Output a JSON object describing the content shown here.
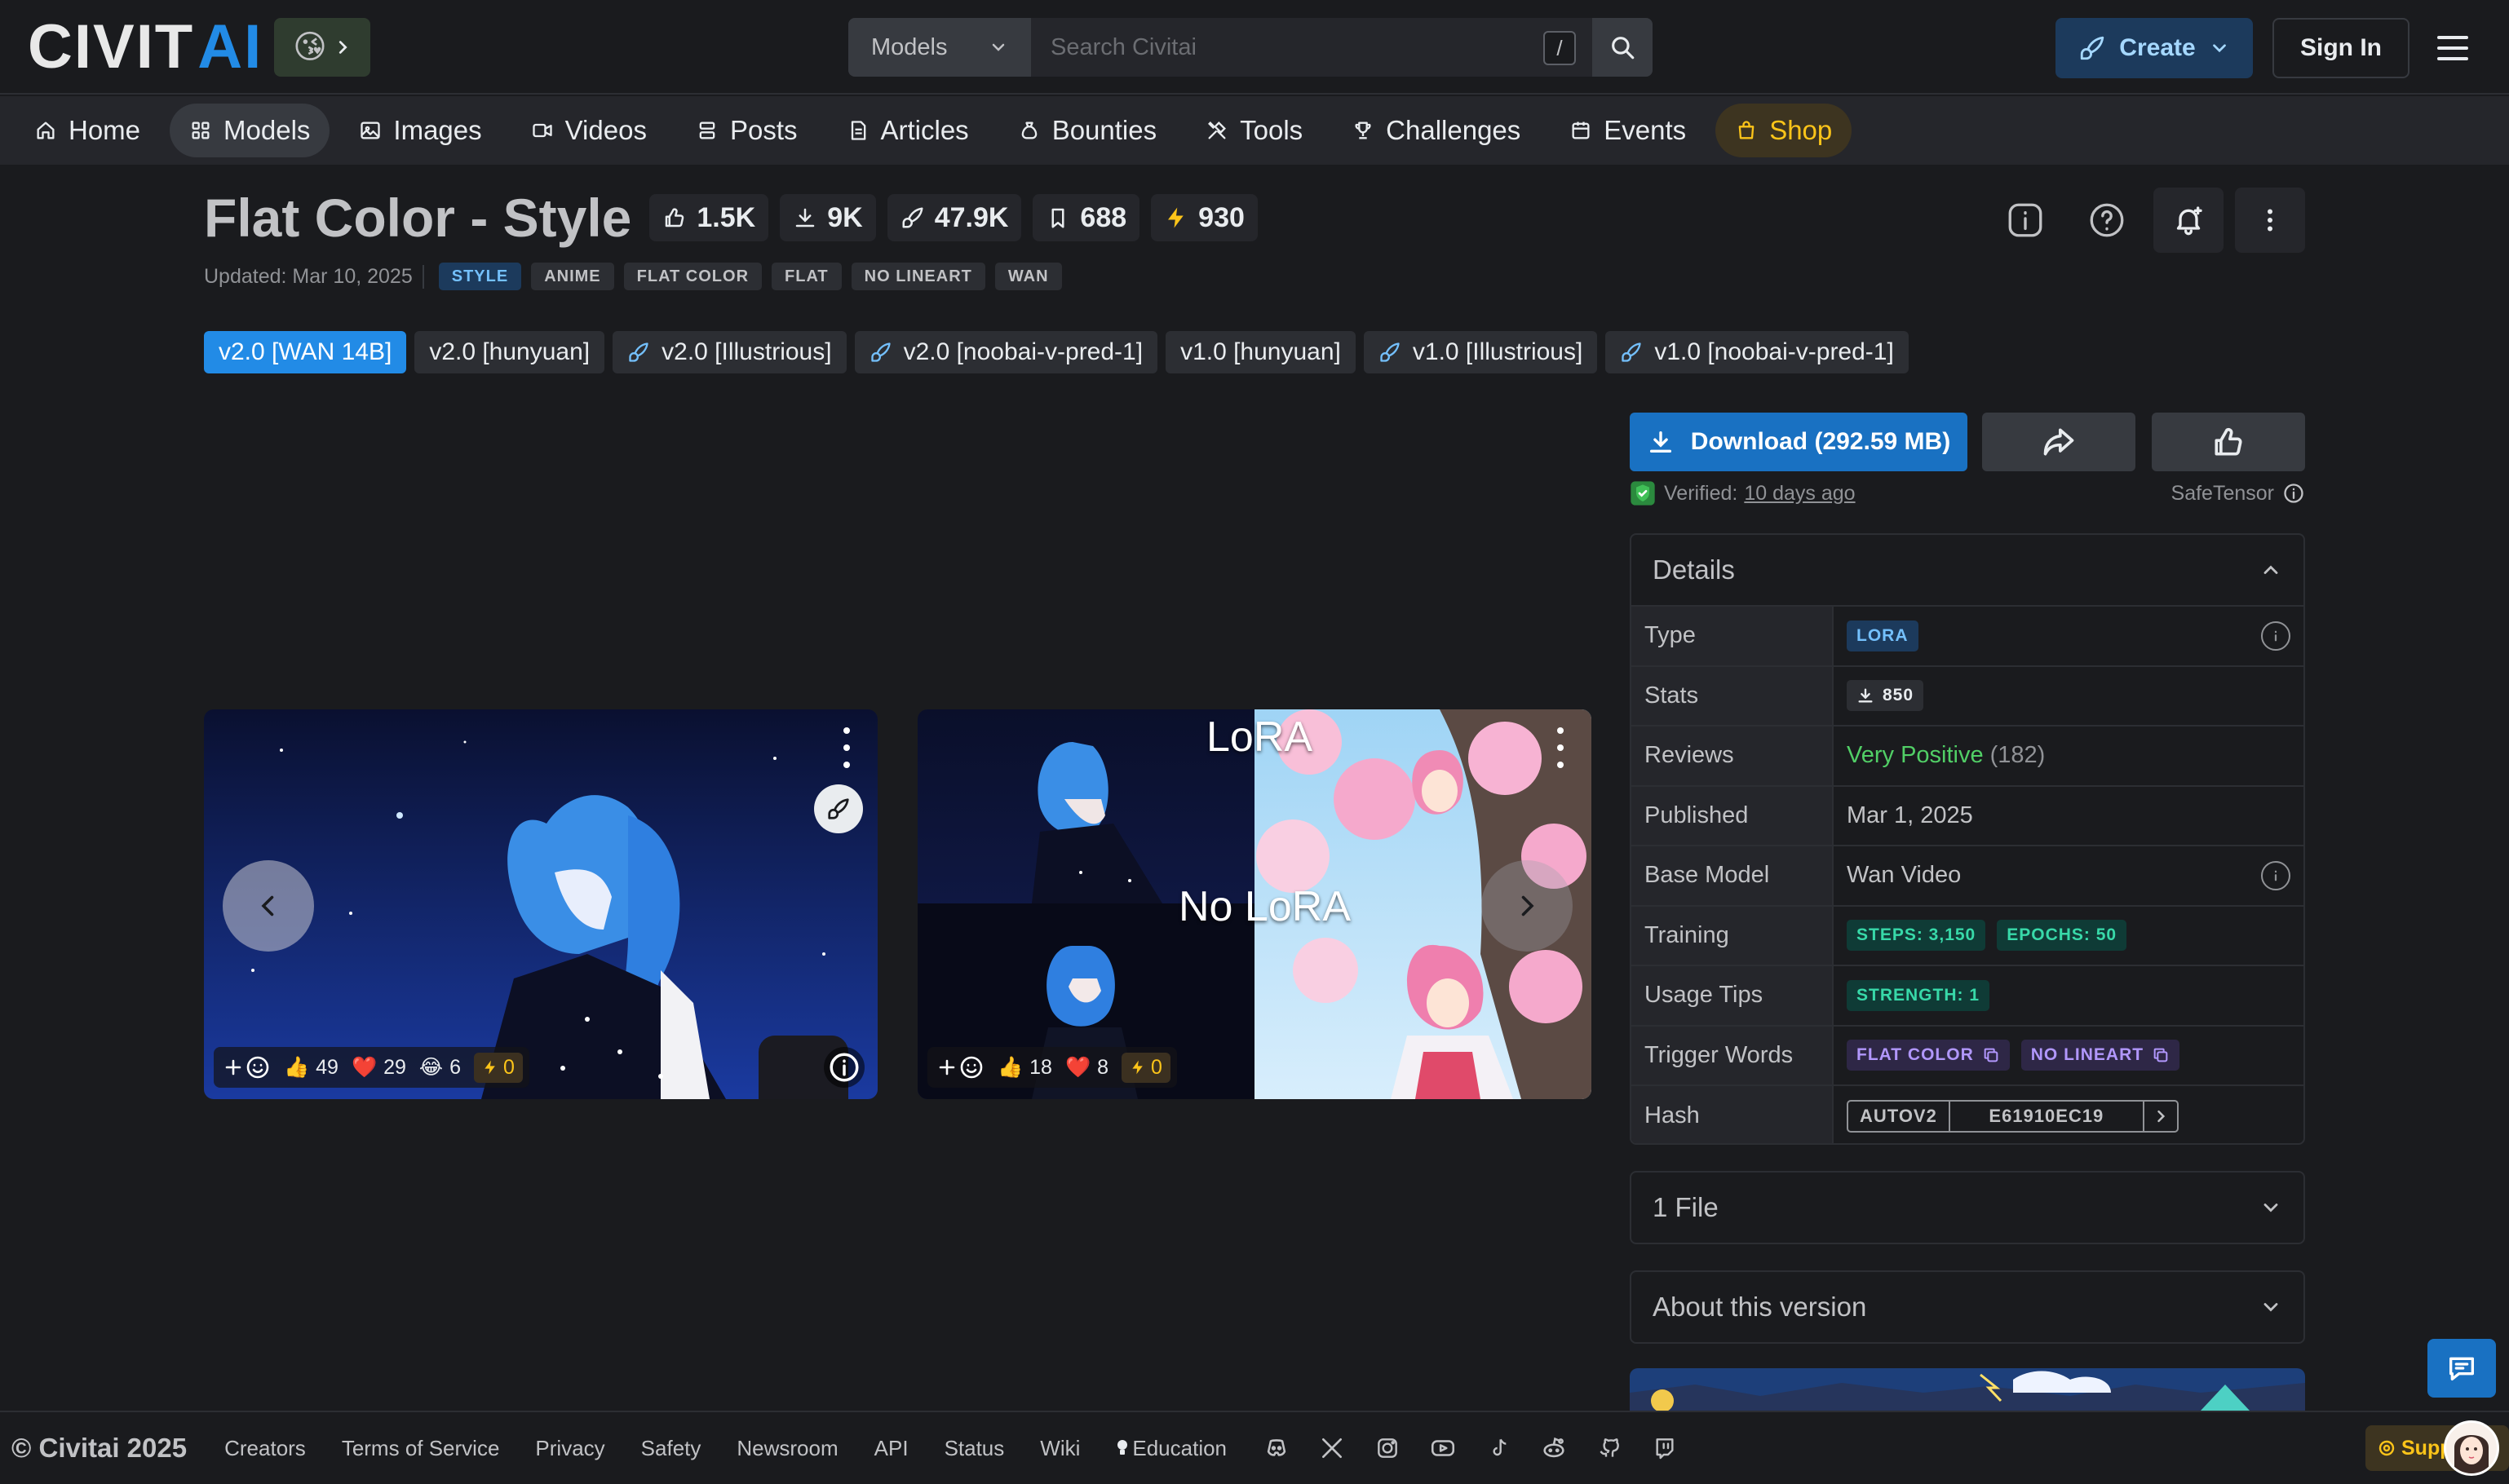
{
  "header": {
    "logo_a": "CIVIT",
    "logo_b": "AI",
    "emoji": "😘",
    "search": {
      "scope": "Models",
      "placeholder": "Search Civitai",
      "shortcut": "/"
    },
    "create_label": "Create",
    "signin_label": "Sign In"
  },
  "nav": {
    "items": [
      {
        "label": "Home",
        "icon": "home-icon"
      },
      {
        "label": "Models",
        "icon": "grid-icon"
      },
      {
        "label": "Images",
        "icon": "photo-icon"
      },
      {
        "label": "Videos",
        "icon": "video-icon"
      },
      {
        "label": "Posts",
        "icon": "stack-icon"
      },
      {
        "label": "Articles",
        "icon": "article-icon"
      },
      {
        "label": "Bounties",
        "icon": "moneybag-icon"
      },
      {
        "label": "Tools",
        "icon": "tools-icon"
      },
      {
        "label": "Challenges",
        "icon": "trophy-icon"
      },
      {
        "label": "Events",
        "icon": "calendar-icon"
      },
      {
        "label": "Shop",
        "icon": "shopping-bag-icon"
      }
    ],
    "active": "Models"
  },
  "model": {
    "title": "Flat Color - Style",
    "stats": {
      "likes": "1.5K",
      "downloads": "9K",
      "generations": "47.9K",
      "bookmarks": "688",
      "buzz": "930"
    },
    "updated": "Updated: Mar 10, 2025",
    "tags": [
      "STYLE",
      "ANIME",
      "FLAT COLOR",
      "FLAT",
      "NO LINEART",
      "WAN"
    ]
  },
  "versions": [
    {
      "label": "v2.0 [WAN 14B]",
      "active": true,
      "linked": false
    },
    {
      "label": "v2.0 [hunyuan]",
      "active": false,
      "linked": false
    },
    {
      "label": "v2.0 [Illustrious]",
      "active": false,
      "linked": true
    },
    {
      "label": "v2.0 [noobai-v-pred-1]",
      "active": false,
      "linked": true
    },
    {
      "label": "v1.0 [hunyuan]",
      "active": false,
      "linked": false
    },
    {
      "label": "v1.0 [Illustrious]",
      "active": false,
      "linked": true
    },
    {
      "label": "v1.0 [noobai-v-pred-1]",
      "active": false,
      "linked": true
    }
  ],
  "gallery": {
    "card1": {
      "reactions": {
        "like": "49",
        "heart": "29",
        "laugh": "6",
        "buzz": "0"
      }
    },
    "card2": {
      "reactions": {
        "like": "18",
        "heart": "8",
        "buzz": "0"
      },
      "overlay_top": "LoRA",
      "overlay_mid": "No LoRA"
    }
  },
  "download": {
    "label": "Download (292.59 MB)",
    "verified_text": "Verified:",
    "verified_time": "10 days ago",
    "format": "SafeTensor"
  },
  "details": {
    "title": "Details",
    "rows": {
      "type_key": "Type",
      "type_val": "LORA",
      "stats_key": "Stats",
      "stats_val": "850",
      "reviews_key": "Reviews",
      "reviews_positive": "Very Positive",
      "reviews_count": "(182)",
      "published_key": "Published",
      "published_val": "Mar 1, 2025",
      "base_key": "Base Model",
      "base_val": "Wan Video",
      "training_key": "Training",
      "steps": "STEPS: 3,150",
      "epochs": "EPOCHS: 50",
      "tips_key": "Usage Tips",
      "strength": "STRENGTH: 1",
      "trigger_key": "Trigger Words",
      "trigger1": "FLAT COLOR",
      "trigger2": "NO LINEART",
      "hash_key": "Hash",
      "hash_type": "AUTOV2",
      "hash_val": "E61910EC19"
    }
  },
  "accordions": {
    "files": "1 File",
    "about": "About this version"
  },
  "footer": {
    "copyright": "© Civitai 2025",
    "links": [
      "Creators",
      "Terms of Service",
      "Privacy",
      "Safety",
      "Newsroom",
      "API",
      "Status",
      "Wiki",
      "Education"
    ],
    "education_icon": "lightbulb-icon",
    "social": [
      "discord-icon",
      "x-icon",
      "instagram-icon",
      "youtube-icon",
      "tiktok-icon",
      "reddit-icon",
      "github-icon",
      "twitch-icon"
    ],
    "support_label": "Supp"
  },
  "colors": {
    "accent": "#228be6",
    "background": "#1a1b1e",
    "positive": "#51cf66",
    "buzz": "#fcc419"
  }
}
